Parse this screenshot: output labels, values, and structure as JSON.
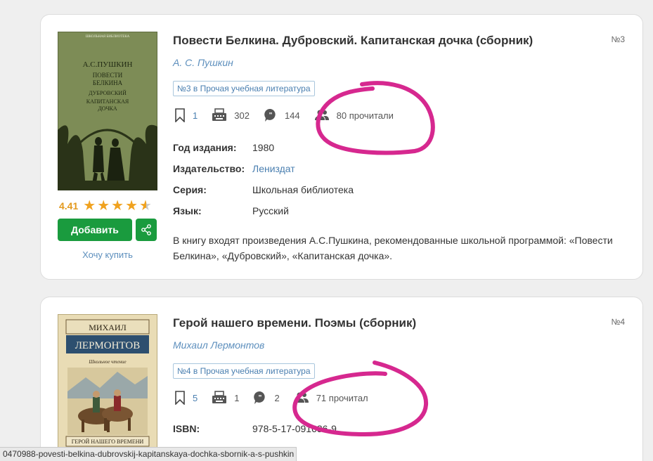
{
  "books": [
    {
      "title": "Повести Белкина. Дубровский. Капитанская дочка (сборник)",
      "number": "№3",
      "author": "А. С. Пушкин",
      "rank_tag": "№3 в Прочая учебная литература",
      "rating": "4.41",
      "rating_stars": 4.41,
      "add_label": "Добавить",
      "want_buy": "Хочу купить",
      "stats": {
        "bookmarks": "1",
        "quotes": "302",
        "reviews": "144",
        "readers": "80 прочитали"
      },
      "meta": [
        {
          "label": "Год издания:",
          "value": "1980",
          "is_link": false
        },
        {
          "label": "Издательство:",
          "value": "Лениздат",
          "is_link": true
        },
        {
          "label": "Серия:",
          "value": "Школьная библиотека",
          "is_link": false
        },
        {
          "label": "Язык:",
          "value": "Русский",
          "is_link": false
        }
      ],
      "description": "В книгу входят произведения А.С.Пушкина, рекомендованные школьной программой: «Повести Белкина», «Дубровский», «Капитанская дочка».",
      "cover": {
        "series": "ШКОЛЬНАЯ БИБЛИОТЕКА",
        "author": "А.С.ПУШКИН",
        "lines": [
          "ПОВЕСТИ",
          "БЕЛКИНА",
          "ДУБРОВСКИЙ",
          "КАПИТАНСКАЯ",
          "ДОЧКА"
        ]
      }
    },
    {
      "title": "Герой нашего времени. Поэмы (сборник)",
      "number": "№4",
      "author": "Михаил Лермонтов",
      "rank_tag": "№4 в Прочая учебная литература",
      "stats": {
        "bookmarks": "5",
        "quotes": "1",
        "reviews": "2",
        "readers": "71 прочитал"
      },
      "meta": [
        {
          "label": "ISBN:",
          "value": "978-5-17-091636-9",
          "is_link": false
        }
      ],
      "cover": {
        "first_name": "МИХАИЛ",
        "last_name": "ЛЕРМОНТОВ",
        "series": "Школьное чтение",
        "book_title": "ГЕРОЙ НАШЕГО ВРЕМЕНИ"
      }
    }
  ],
  "status_url": "0470988-povesti-belkina-dubrovskij-kapitanskaya-dochka-sbornik-a-s-pushkin",
  "colors": {
    "accent_green": "#1a9b3e",
    "link_blue": "#4a7fb0",
    "star_orange": "#f0a21f",
    "annotation_pink": "#d6288f"
  }
}
